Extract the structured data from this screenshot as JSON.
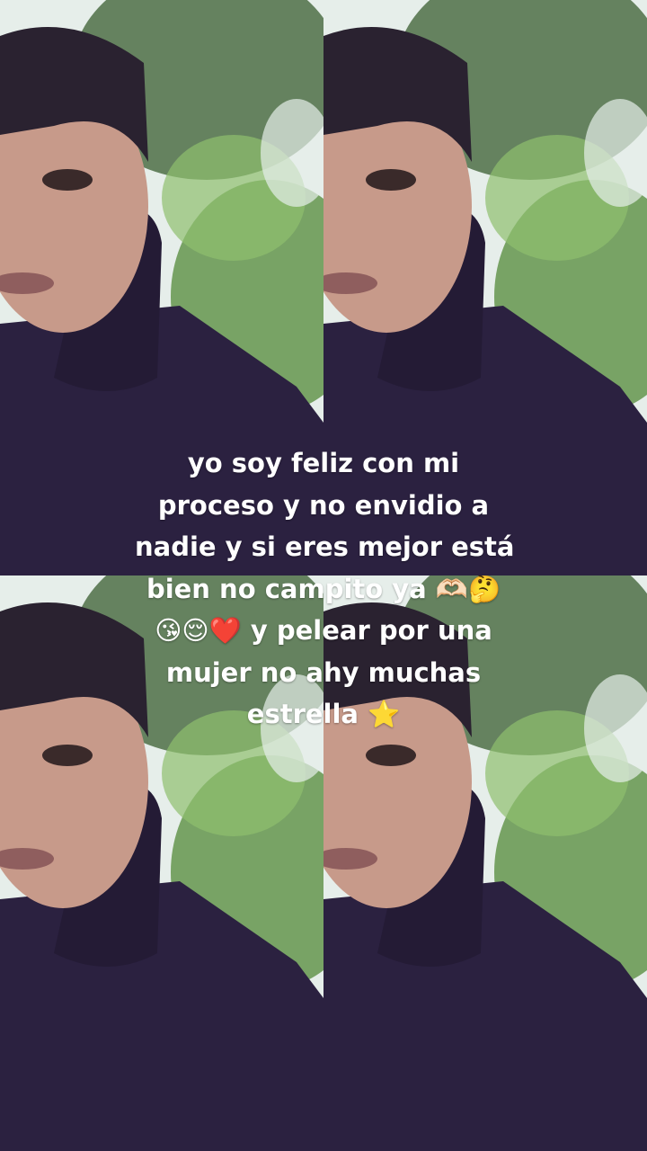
{
  "caption": {
    "lines": [
      "yo soy feliz con mi",
      "proceso y no envidio a",
      "nadie y si eres mejor está",
      "bien no campito ya 🫶🏻🤔",
      "😘😌❤️ y pelear por una",
      "mujer no ahy muchas",
      "estrella ⭐"
    ]
  },
  "colors": {
    "sky": "#e6eeea",
    "foliage_dark": "#3d5c3a",
    "foliage_light": "#8fbf6e",
    "jacket": "#2b2140",
    "skin": "#c79a8a",
    "hair": "#2a2230"
  }
}
